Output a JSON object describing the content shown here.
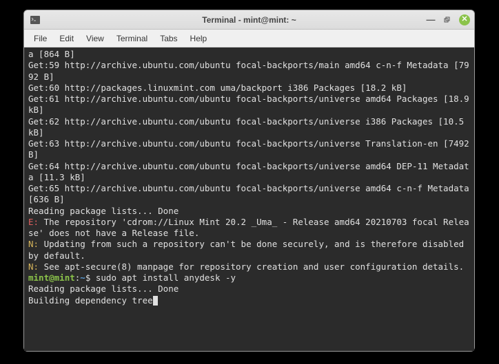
{
  "window": {
    "title": "Terminal - mint@mint: ~"
  },
  "menu": {
    "file": "File",
    "edit": "Edit",
    "view": "View",
    "terminal": "Terminal",
    "tabs": "Tabs",
    "help": "Help"
  },
  "term": {
    "line_top": "a [864 B]",
    "get59": "Get:59 http://archive.ubuntu.com/ubuntu focal-backports/main amd64 c-n-f Metadata [7992 B]",
    "get60": "Get:60 http://packages.linuxmint.com uma/backport i386 Packages [18.2 kB]",
    "get61": "Get:61 http://archive.ubuntu.com/ubuntu focal-backports/universe amd64 Packages [18.9 kB]",
    "get62": "Get:62 http://archive.ubuntu.com/ubuntu focal-backports/universe i386 Packages [10.5 kB]",
    "get63": "Get:63 http://archive.ubuntu.com/ubuntu focal-backports/universe Translation-en [7492 B]",
    "get64": "Get:64 http://archive.ubuntu.com/ubuntu focal-backports/universe amd64 DEP-11 Metadata [11.3 kB]",
    "get65": "Get:65 http://archive.ubuntu.com/ubuntu focal-backports/universe amd64 c-n-f Metadata [636 B]",
    "reading1": "Reading package lists... Done",
    "err_prefix": "E:",
    "err_msg": " The repository 'cdrom://Linux Mint 20.2 _Uma_ - Release amd64 20210703 focal Release' does not have a Release file.",
    "note1_prefix": "N:",
    "note1_msg": " Updating from such a repository can't be done securely, and is therefore disabled by default.",
    "note2_prefix": "N:",
    "note2_msg": " See apt-secure(8) manpage for repository creation and user configuration details.",
    "prompt_user": "mint",
    "prompt_at": "@",
    "prompt_host": "mint",
    "prompt_colon": ":",
    "prompt_path": "~",
    "prompt_dollar": "$",
    "cmd": " sudo apt install anydesk -y",
    "reading2": "Reading package lists... Done",
    "building": "Building dependency tree"
  }
}
